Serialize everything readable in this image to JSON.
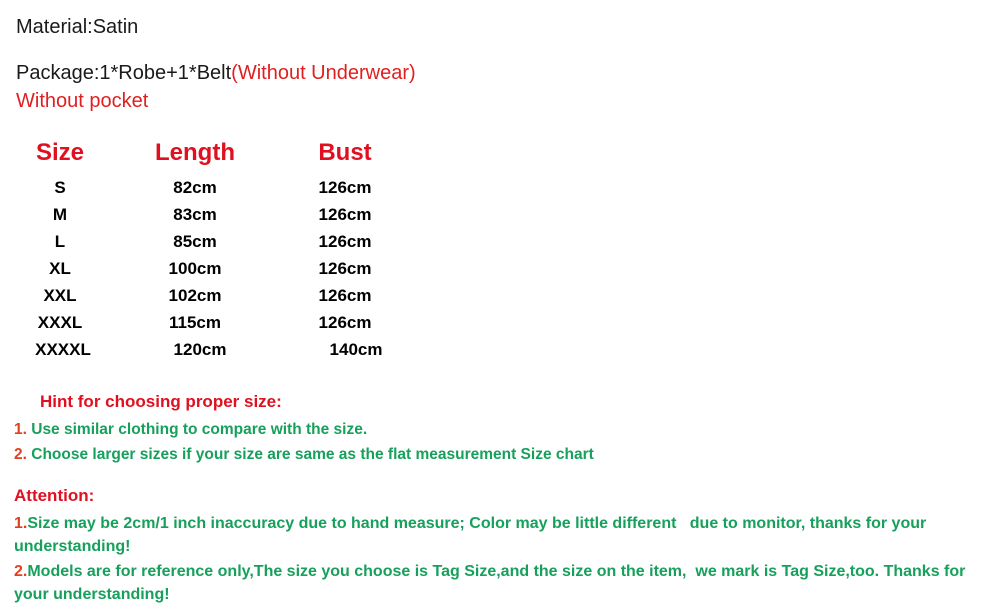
{
  "colors": {
    "red": "#e01020",
    "red_text": "#e02020",
    "green": "#17a05c",
    "black": "#1a1a1a",
    "background": "#ffffff"
  },
  "info": {
    "material": "Material:Satin",
    "package_black": "Package:1*Robe+1*Belt",
    "package_red": "(Without Underwear)",
    "pocket": "Without pocket"
  },
  "size_chart": {
    "headers": [
      "Size",
      "Length",
      "Bust"
    ],
    "rows": [
      {
        "size": "S",
        "length": "82cm",
        "bust": "126cm"
      },
      {
        "size": "M",
        "length": "83cm",
        "bust": "126cm"
      },
      {
        "size": "L",
        "length": "85cm",
        "bust": "126cm"
      },
      {
        "size": "XL",
        "length": "100cm",
        "bust": "126cm"
      },
      {
        "size": "XXL",
        "length": "102cm",
        "bust": "126cm"
      },
      {
        "size": "XXXL",
        "length": "115cm",
        "bust": "126cm"
      },
      {
        "size": "XXXXL",
        "length": "120cm",
        "bust": "140cm"
      }
    ]
  },
  "hint": {
    "title": "Hint for choosing proper size:",
    "items": [
      {
        "number": "1.",
        "text": " Use similar clothing to compare with the size."
      },
      {
        "number": "2.",
        "text": " Choose larger sizes if your size are same as the flat measurement Size chart"
      }
    ]
  },
  "attention": {
    "title": "Attention:",
    "items": [
      {
        "number": "1.",
        "text": "Size may be 2cm/1 inch inaccuracy due to hand measure; Color may be little different   due to monitor, thanks for your understanding!"
      },
      {
        "number": "2.",
        "text": "Models are for reference only,The size you choose is Tag Size,and the size on the item,  we mark is Tag Size,too. Thanks for your understanding!"
      }
    ]
  }
}
